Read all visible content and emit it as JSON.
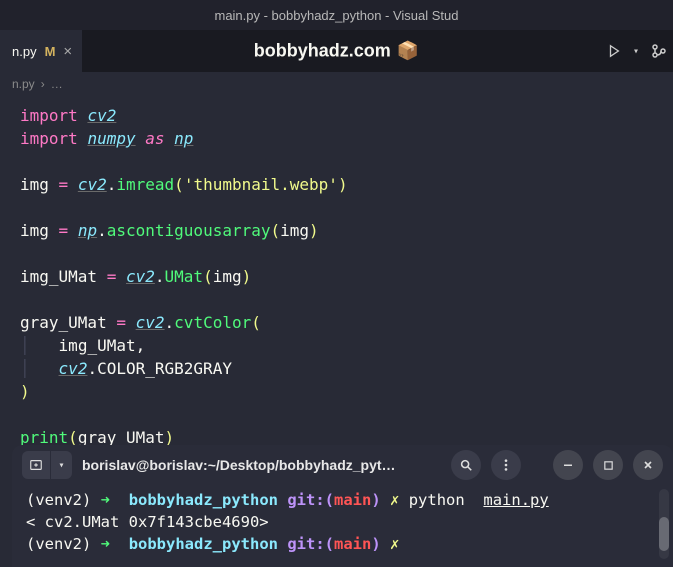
{
  "titlebar": {
    "text": "main.py - bobbyhadz_python - Visual Stud"
  },
  "tab": {
    "filename": "n.py",
    "modified_marker": "M",
    "close_glyph": "×"
  },
  "watermark": {
    "text": "bobbyhadz.com",
    "cube": "📦"
  },
  "breadcrumb": {
    "file": "n.py",
    "sep": "›",
    "more": "…"
  },
  "code": {
    "l1_import": "import",
    "l1_mod": "cv2",
    "l2_import": "import",
    "l2_mod": "numpy",
    "l2_as": "as",
    "l2_alias": "np",
    "l4_id": "img",
    "l4_eq": "=",
    "l4_mod": "cv2",
    "l4_dot": ".",
    "l4_fn": "imread",
    "l4_lp": "(",
    "l4_str": "'thumbnail.webp'",
    "l4_rp": ")",
    "l6_id": "img",
    "l6_eq": "=",
    "l6_mod": "np",
    "l6_dot": ".",
    "l6_fn": "ascontiguousarray",
    "l6_lp": "(",
    "l6_arg": "img",
    "l6_rp": ")",
    "l8_id": "img_UMat",
    "l8_eq": "=",
    "l8_mod": "cv2",
    "l8_dot": ".",
    "l8_fn": "UMat",
    "l8_lp": "(",
    "l8_arg": "img",
    "l8_rp": ")",
    "l10_id": "gray_UMat",
    "l10_eq": "=",
    "l10_mod": "cv2",
    "l10_dot": ".",
    "l10_fn": "cvtColor",
    "l10_lp": "(",
    "l11_arg1": "img_UMat,",
    "l11_guide": "│",
    "l12_mod": "cv2",
    "l12_dot": ".",
    "l12_const": "COLOR_RGB2GRAY",
    "l12_guide": "│",
    "l13_rp": ")",
    "l15_fn": "print",
    "l15_lp": "(",
    "l15_arg": "gray_UMat",
    "l15_rp": ")"
  },
  "terminal": {
    "title": "borislav@borislav:~/Desktop/bobbyhadz_pyt…",
    "line1": {
      "venv": "(venv2)",
      "arrow": "➜",
      "dir": "bobbyhadz_python",
      "git": "git:",
      "lp": "(",
      "branch": "main",
      "rp": ")",
      "lightning": "✗",
      "cmd_py": "python",
      "cmd_file": "main.py"
    },
    "line2": {
      "text": "< cv2.UMat 0x7f143cbe4690>"
    },
    "line3": {
      "venv": "(venv2)",
      "arrow": "➜",
      "dir": "bobbyhadz_python",
      "git": "git:",
      "lp": "(",
      "branch": "main",
      "rp": ")",
      "lightning": "✗"
    }
  }
}
